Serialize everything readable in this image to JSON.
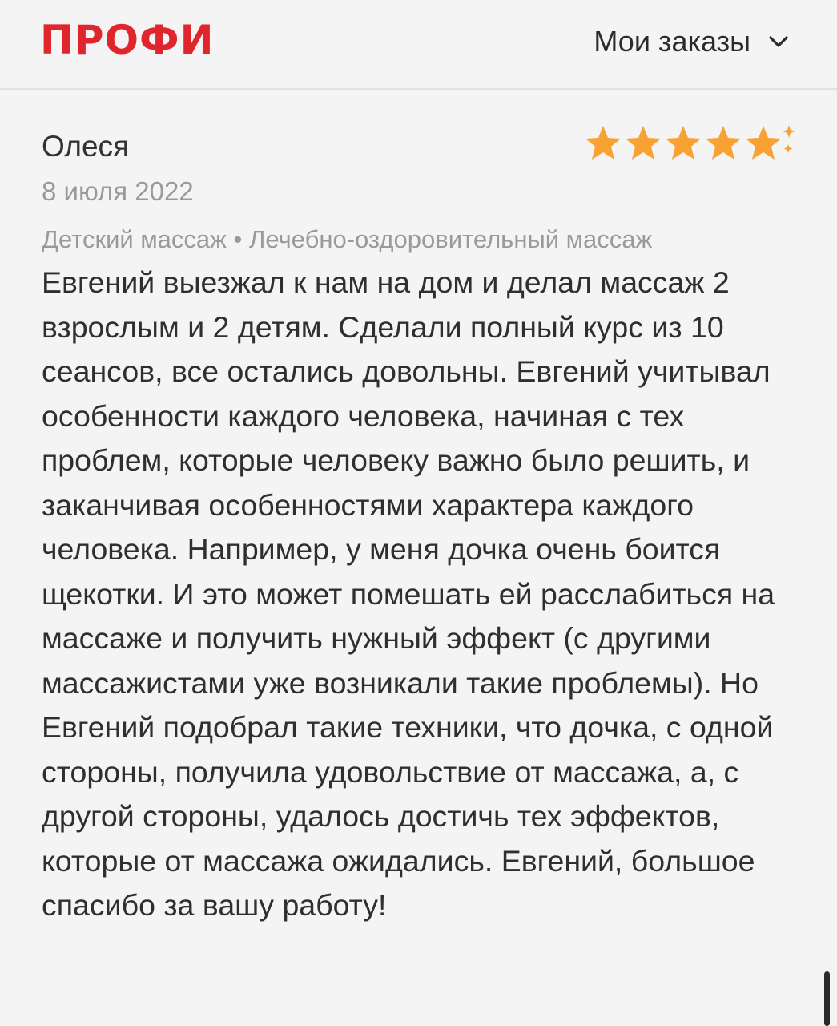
{
  "header": {
    "logo": "ПРОФИ",
    "menu_label": "Мои заказы",
    "chevron_icon": "chevron-down-icon"
  },
  "review": {
    "author": "Олеся",
    "date": "8 июля 2022",
    "categories": "Детский массаж • Лечебно-оздоровительный массаж",
    "rating": 5,
    "rating_max": 5,
    "star_color": "#f7a233",
    "text": "Евгений выезжал к нам на дом и делал массаж 2 взрослым и 2 детям. Сделали полный курс из 10 сеансов, все остались довольны. Евгений учитывал особенности каждого человека, начиная с тех проблем, которые человеку важно было решить, и заканчивая особенностями характера каждого человека. Например, у меня дочка очень боится щекотки. И это может помешать ей расслабиться на массаже и получить нужный эффект (с другими массажистами уже возникали такие проблемы). Но Евгений подобрал такие техники, что дочка, с одной стороны, получила удовольствие от массажа, а, с другой стороны, удалось достичь тех эффектов, которые от массажа ожидались. Евгений, большое спасибо за вашу работу!"
  },
  "colors": {
    "brand": "#e0262d",
    "background": "#f4f4f4",
    "muted_text": "#9a9a9a"
  }
}
